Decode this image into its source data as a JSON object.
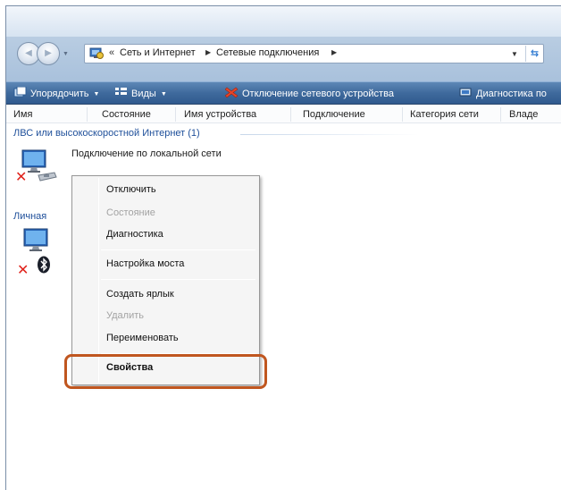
{
  "address_bar": {
    "prefix": "«",
    "crumbs": [
      "Сеть и Интернет",
      "Сетевые подключения"
    ]
  },
  "toolbar": {
    "organize": "Упорядочить",
    "views": "Виды",
    "disable": "Отключение сетевого устройства",
    "diagnose": "Диагностика по"
  },
  "columns": [
    "Имя",
    "Состояние",
    "Имя устройства",
    "Подключение",
    "Категория сети",
    "Владе"
  ],
  "groups": {
    "lan_title": "ЛВС или высокоскоростной Интернет (1)",
    "pan_title_partial": "Личная",
    "lan_item_label": "Подключение по локальной сети"
  },
  "context_menu": {
    "items": [
      {
        "label": "Отключить",
        "enabled": true
      },
      {
        "label": "Состояние",
        "enabled": false
      },
      {
        "label": "Диагностика",
        "enabled": true
      },
      {
        "label": "Настройка моста",
        "enabled": true
      },
      {
        "label": "Создать ярлык",
        "enabled": true
      },
      {
        "label": "Удалить",
        "enabled": false
      },
      {
        "label": "Переименовать",
        "enabled": true
      },
      {
        "label": "Свойства",
        "enabled": true,
        "default": true
      }
    ],
    "highlight_color": "#c0561f"
  },
  "icons": {
    "network": "network-adapter-icon",
    "error": "red-x-icon",
    "bluetooth": "bluetooth-icon"
  }
}
